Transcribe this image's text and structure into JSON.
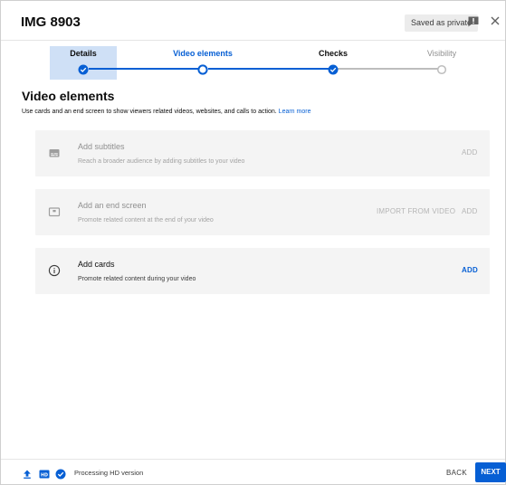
{
  "header": {
    "title": "IMG 8903",
    "saved_badge": "Saved as private"
  },
  "stepper": {
    "steps": [
      {
        "label": "Details",
        "state": "done"
      },
      {
        "label": "Video elements",
        "state": "active"
      },
      {
        "label": "Checks",
        "state": "done"
      },
      {
        "label": "Visibility",
        "state": "todo"
      }
    ]
  },
  "section": {
    "title": "Video elements",
    "description": "Use cards and an end screen to show viewers related videos, websites, and calls to action.",
    "learn_more": "Learn more"
  },
  "cards": [
    {
      "title": "Add subtitles",
      "subtitle": "Reach a broader audience by adding subtitles to your video",
      "action": "ADD",
      "enabled": false,
      "icon": "subtitles-icon"
    },
    {
      "title": "Add an end screen",
      "subtitle": "Promote related content at the end of your video",
      "secondary_action": "IMPORT FROM VIDEO",
      "action": "ADD",
      "enabled": false,
      "icon": "end-screen-icon"
    },
    {
      "title": "Add cards",
      "subtitle": "Promote related content during your video",
      "action": "ADD",
      "enabled": true,
      "icon": "info-icon"
    }
  ],
  "footer": {
    "status": "Processing HD version",
    "hd_badge": "HD",
    "back_label": "BACK",
    "next_label": "NEXT"
  },
  "colors": {
    "accent": "#065fd4",
    "step_highlight": "#cfe0f6",
    "card_bg": "#f4f4f4"
  }
}
